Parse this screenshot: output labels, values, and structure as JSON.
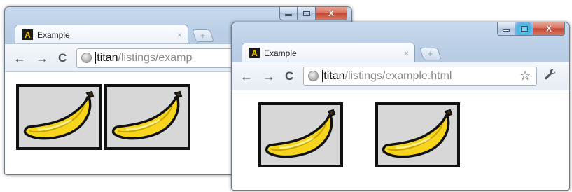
{
  "windows": [
    {
      "id": "back",
      "tab": {
        "title": "Example",
        "favicon_letter": "A",
        "close_glyph": "×"
      },
      "newtab_glyph": "+",
      "toolbar": {
        "back": "←",
        "forward": "→",
        "reload": "C"
      },
      "omnibox": {
        "host": "titan",
        "path": "/listings/examp"
      },
      "controls": {
        "minimize": "–",
        "maximize": "□",
        "close": "X"
      },
      "images": [
        {
          "alt": "banana"
        },
        {
          "alt": "banana"
        }
      ]
    },
    {
      "id": "front",
      "tab": {
        "title": "Example",
        "favicon_letter": "A",
        "close_glyph": "×"
      },
      "newtab_glyph": "+",
      "toolbar": {
        "back": "←",
        "forward": "→",
        "reload": "C",
        "star": "☆",
        "wrench": "🔧"
      },
      "omnibox": {
        "host": "titan",
        "path": "/listings/example.html"
      },
      "controls": {
        "minimize": "–",
        "maximize": "□",
        "close": "X"
      },
      "images": [
        {
          "alt": "banana"
        },
        {
          "alt": "banana"
        }
      ]
    }
  ],
  "colors": {
    "frame": "#bcd0e7",
    "banana_fill": "#f7d51d",
    "banana_outline": "#111111",
    "image_bg": "#d7d7d7",
    "close_button": "#c4442f"
  }
}
